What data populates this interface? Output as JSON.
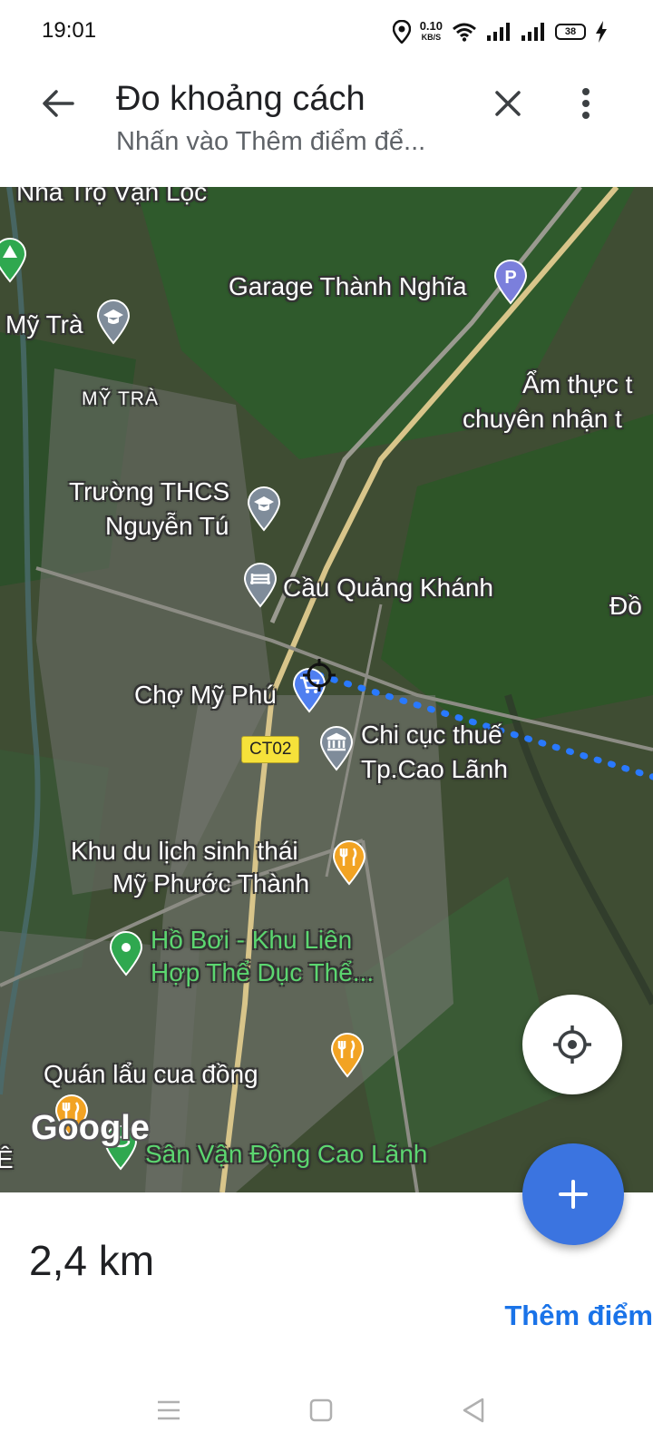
{
  "status_bar": {
    "time": "19:01",
    "net_speed_value": "0.10",
    "net_speed_unit": "KB/S",
    "battery": "38"
  },
  "app_bar": {
    "title": "Đo khoảng cách",
    "subtitle": "Nhấn vào Thêm điểm để..."
  },
  "map": {
    "labels": {
      "nha_tro": "Nhà Trọ Vạn Lộc",
      "garage": "Garage Thành Nghĩa",
      "my_tra_school": "Mỹ Trà",
      "my_tra_area": "MỸ TRÀ",
      "am_thuc_1": "Ẩm thực t",
      "am_thuc_2": "chuyên nhận t",
      "truong_1": "Trường THCS",
      "truong_2": "Nguyễn Tú",
      "cau": "Cầu Quảng Khánh",
      "do": "Đồ",
      "cho": "Chợ Mỹ Phú",
      "chi_cuc_1": "Chi cục thuế",
      "chi_cuc_2": "Tp.Cao Lãnh",
      "khu_du_lich_1": "Khu du lịch sinh thái",
      "khu_du_lich_2": "Mỹ Phước Thành",
      "ho_boi_1": "Hồ Bơi - Khu Liên",
      "ho_boi_2": "Hợp Thể Dục Thể...",
      "quan_lau": "Quán lẩu cua đồng",
      "san_van_dong": "Sân Vận Động Cao Lãnh",
      "edge_e": "Ê"
    },
    "route_badge": "CT02",
    "logo": "Google"
  },
  "result": {
    "distance": "2,4 km",
    "add_point_label": "Thêm điểm"
  },
  "colors": {
    "accent": "#1a73e8",
    "fab": "#3b74e0",
    "route": "#2979ff"
  }
}
